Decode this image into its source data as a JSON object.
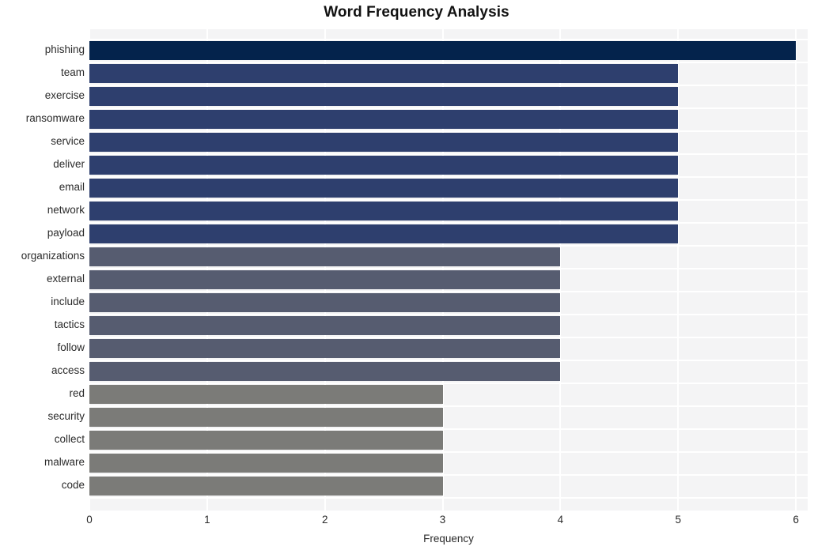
{
  "chart_data": {
    "type": "bar",
    "orientation": "horizontal",
    "title": "Word Frequency Analysis",
    "xlabel": "Frequency",
    "ylabel": "",
    "xlim": [
      0,
      6.1
    ],
    "xticks": [
      0,
      1,
      2,
      3,
      4,
      5,
      6
    ],
    "xtick_labels": [
      "0",
      "1",
      "2",
      "3",
      "4",
      "5",
      "6"
    ],
    "grid": true,
    "grid_color": "#ffffff",
    "plot_background": "#f4f4f5",
    "figure_background": "#ffffff",
    "legend": null,
    "categories": [
      "phishing",
      "team",
      "exercise",
      "ransomware",
      "service",
      "deliver",
      "email",
      "network",
      "payload",
      "organizations",
      "external",
      "include",
      "tactics",
      "follow",
      "access",
      "red",
      "security",
      "collect",
      "malware",
      "code"
    ],
    "values": [
      6,
      5,
      5,
      5,
      5,
      5,
      5,
      5,
      5,
      4,
      4,
      4,
      4,
      4,
      4,
      3,
      3,
      3,
      3,
      3
    ],
    "bar_colors": [
      "#04234c",
      "#2e3f6e",
      "#2e3f6e",
      "#2e3f6e",
      "#2e3f6e",
      "#2e3f6e",
      "#2e3f6e",
      "#2e3f6e",
      "#2e3f6e",
      "#565c70",
      "#565c70",
      "#565c70",
      "#565c70",
      "#565c70",
      "#565c70",
      "#7b7b78",
      "#7b7b78",
      "#7b7b78",
      "#7b7b78",
      "#7b7b78"
    ],
    "palette": {
      "value_6": "#04234c",
      "value_5": "#2e3f6e",
      "value_4": "#565c70",
      "value_3": "#7b7b78"
    }
  }
}
